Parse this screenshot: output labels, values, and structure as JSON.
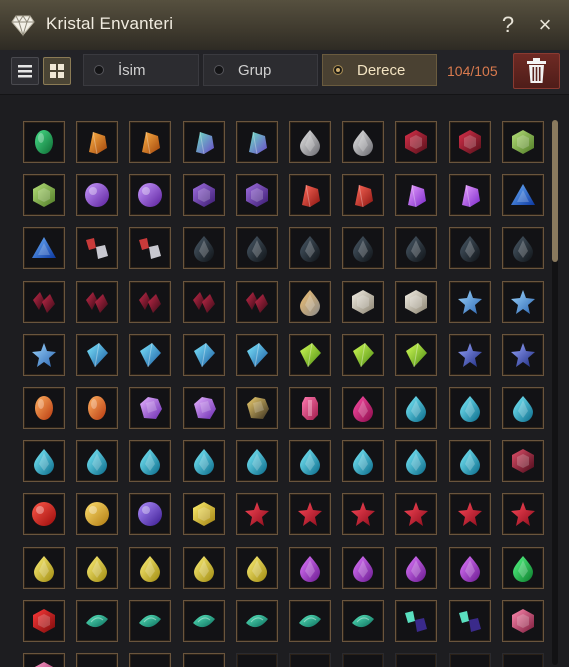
{
  "window": {
    "title": "Kristal Envanteri",
    "help_label": "?",
    "close_label": "×"
  },
  "toolbar": {
    "sort_tabs": [
      {
        "label": "İsim",
        "selected": false
      },
      {
        "label": "Grup",
        "selected": false
      },
      {
        "label": "Derece",
        "selected": true
      }
    ],
    "count": "104/105",
    "view_mode": "grid"
  },
  "colors": {
    "accent_gold": "#a88d55",
    "count_orange": "#d97a4e",
    "trash_red": "#6e2a24"
  },
  "inventory": {
    "rows": [
      [
        "green-emerald",
        "orange-shard",
        "orange-shard",
        "teal-violet-shard",
        "teal-violet-shard",
        "silver-drop",
        "silver-drop",
        "red-stone",
        "red-stone",
        "green-stone"
      ],
      [
        "green-stone",
        "violet-round",
        "violet-round",
        "violet-hexagon",
        "violet-hexagon",
        "red-shard",
        "red-shard",
        "violet-shard",
        "violet-shard",
        "blue-triangle"
      ],
      [
        "blue-triangle",
        "red-silver-pair",
        "red-silver-pair",
        "dark-drop",
        "dark-drop",
        "dark-drop",
        "dark-drop",
        "dark-drop",
        "dark-drop",
        "dark-drop"
      ],
      [
        "crimson-cluster",
        "crimson-cluster",
        "crimson-cluster",
        "crimson-cluster",
        "crimson-cluster",
        "amber-silver-drop",
        "white-hexagon",
        "white-hexagon",
        "blue-star",
        "blue-star"
      ],
      [
        "blue-star",
        "cyan-kite",
        "cyan-kite",
        "cyan-kite",
        "cyan-kite",
        "lime-kite",
        "lime-kite",
        "lime-kite",
        "navy-star",
        "navy-star"
      ],
      [
        "orange-oval",
        "orange-oval",
        "violet-rough",
        "violet-rough",
        "gold-dark-rough",
        "pink-crystal",
        "magenta-drop",
        "cyan-drop",
        "cyan-drop",
        "cyan-drop"
      ],
      [
        "cyan-drop",
        "cyan-drop",
        "cyan-drop",
        "cyan-drop",
        "cyan-drop",
        "cyan-drop",
        "cyan-drop",
        "cyan-drop",
        "cyan-drop",
        "crimson-stone"
      ],
      [
        "red-orb",
        "gold-orb",
        "violet-orb",
        "gold-faceted",
        "red-star",
        "red-star",
        "red-star",
        "red-star",
        "red-star",
        "red-star"
      ],
      [
        "yellow-drop",
        "yellow-drop",
        "yellow-drop",
        "yellow-drop",
        "yellow-drop",
        "violet-drop",
        "violet-drop",
        "violet-drop",
        "violet-drop",
        "green-drop"
      ],
      [
        "red-hexgem",
        "teal-marquise",
        "teal-marquise",
        "teal-marquise",
        "teal-marquise",
        "teal-marquise",
        "teal-marquise",
        "teal-twin",
        "teal-twin",
        "rose-stone"
      ],
      [
        "pink-stone",
        "teal-marquise",
        "teal-marquise",
        "teal-marquise",
        "empty",
        "empty",
        "empty",
        "empty",
        "empty",
        "empty"
      ]
    ]
  }
}
